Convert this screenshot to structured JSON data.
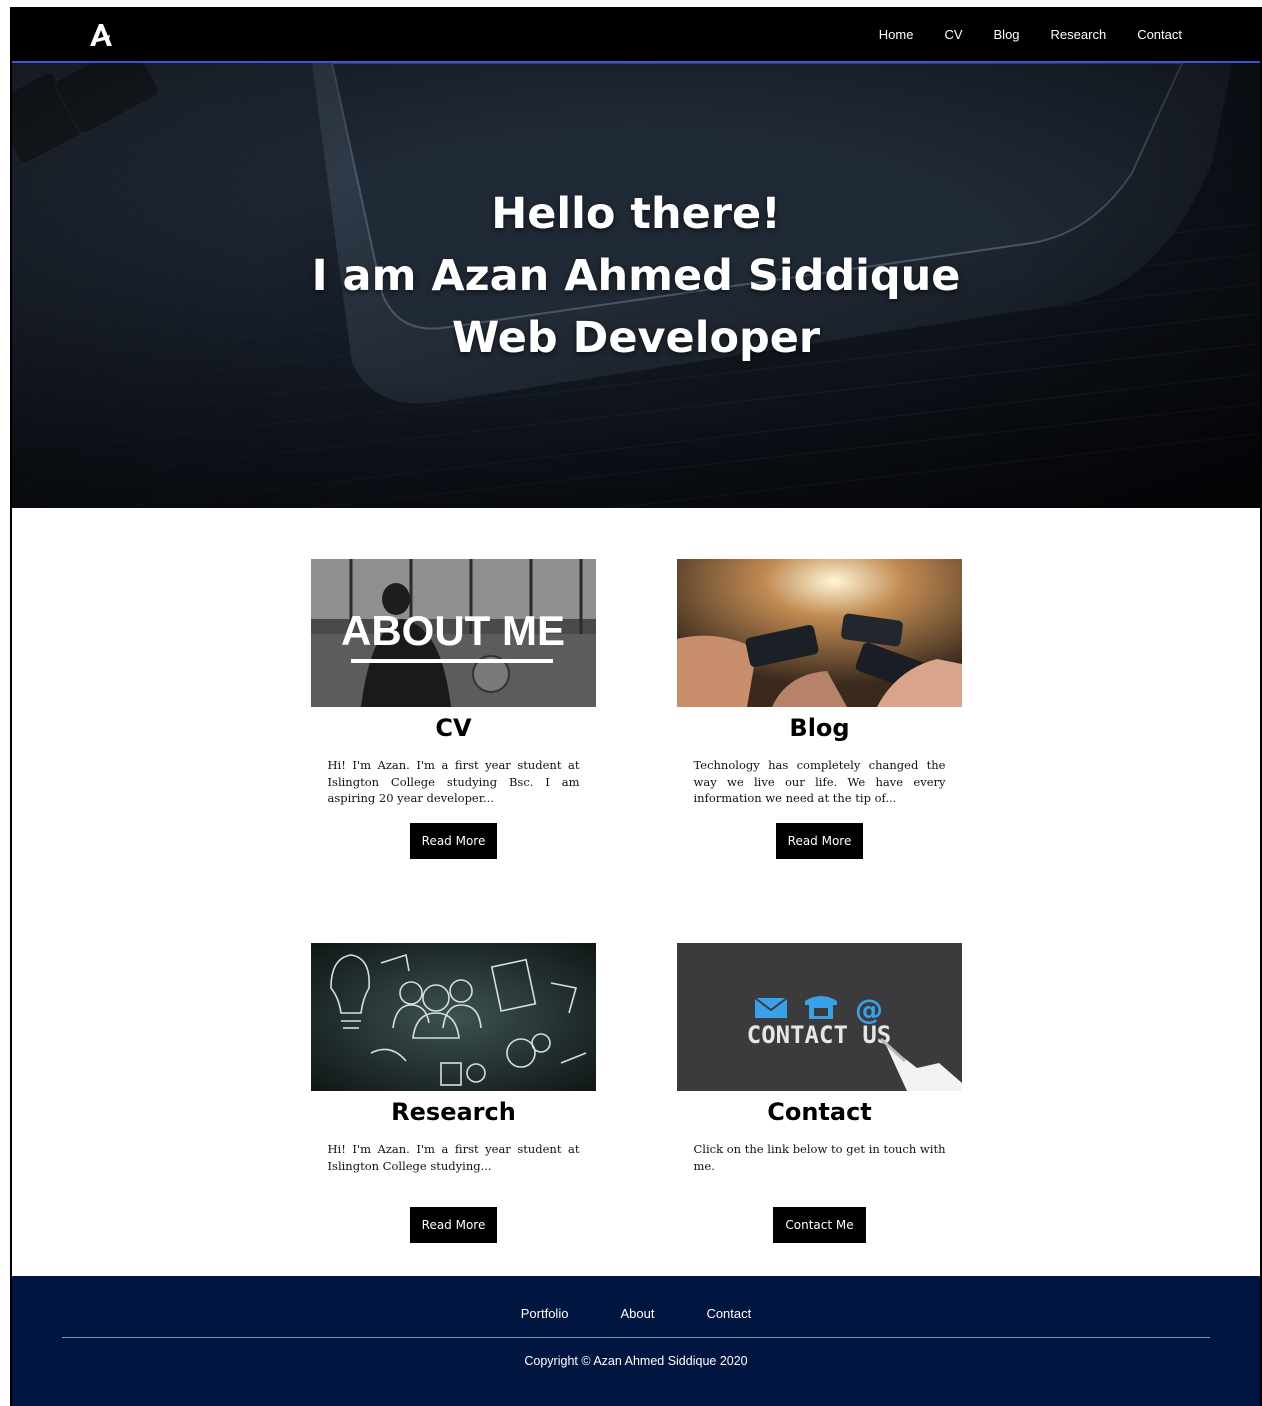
{
  "nav": {
    "logo_letter": "A",
    "links": [
      "Home",
      "CV",
      "Blog",
      "Research",
      "Contact"
    ]
  },
  "hero": {
    "line1": "Hello there!",
    "line2": "I am Azan Ahmed Siddique",
    "line3": "Web Developer"
  },
  "cards": [
    {
      "title": "CV",
      "image_text": "ABOUT ME",
      "text": "Hi! I'm Azan. I'm a first year student at Islington College studying Bsc. I am aspiring 20 year developer...",
      "button": "Read More"
    },
    {
      "title": "Blog",
      "text": "Technology has completely changed the way we live our life. We have every information we need at the tip of...",
      "button": "Read More"
    },
    {
      "title": "Research",
      "text": "Hi! I'm Azan. I'm a first year student at Islington College studying...",
      "button": "Read More"
    },
    {
      "title": "Contact",
      "image_text": "CONTACT US",
      "text": "Click on the link below to get in touch with me.",
      "button": "Contact Me"
    }
  ],
  "footer": {
    "links": [
      "Portfolio",
      "About",
      "Contact"
    ],
    "copyright": "Copyright © Azan Ahmed Siddique 2020"
  },
  "colors": {
    "nav_bg": "#000000",
    "nav_border": "#3b55d8",
    "footer_bg": "#001540",
    "button_bg": "#000000",
    "contact_icons": "#3aa0e8"
  }
}
